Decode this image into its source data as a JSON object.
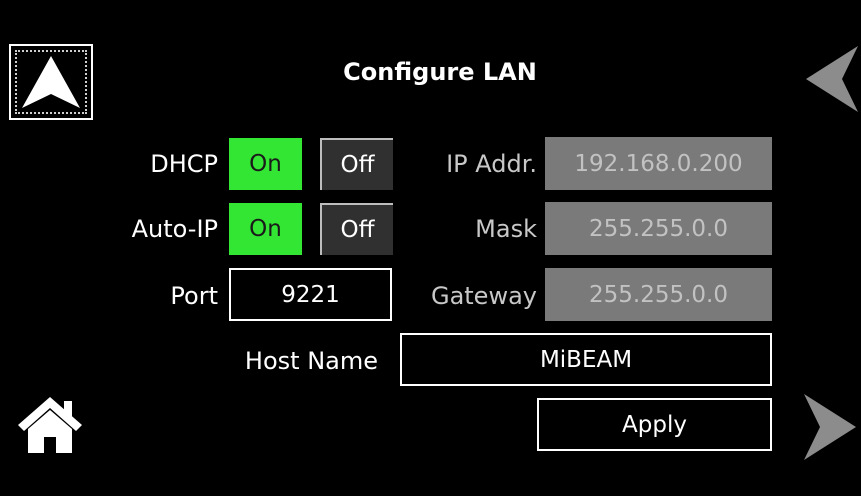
{
  "header": {
    "title": "Configure LAN"
  },
  "nav": {
    "up_icon": "up-arrow-icon",
    "back_icon": "left-arrow-icon",
    "forward_icon": "right-arrow-icon",
    "home_icon": "home-icon"
  },
  "dhcp": {
    "label": "DHCP",
    "on_label": "On",
    "off_label": "Off",
    "selected": "On"
  },
  "auto_ip": {
    "label": "Auto-IP",
    "on_label": "On",
    "off_label": "Off",
    "selected": "On"
  },
  "port": {
    "label": "Port",
    "value": "9221"
  },
  "ip_addr": {
    "label": "IP Addr.",
    "value": "192.168.0.200"
  },
  "mask": {
    "label": "Mask",
    "value": "255.255.0.0"
  },
  "gateway": {
    "label": "Gateway",
    "value": "255.255.0.0"
  },
  "host_name": {
    "label": "Host Name",
    "value": "MiBEAM"
  },
  "apply": {
    "label": "Apply"
  },
  "colors": {
    "background": "#000000",
    "on_active": "#33e633",
    "off_inactive": "#303030",
    "disabled_field": "#7a7a7a",
    "arrow_gray": "#8c8c8c"
  }
}
